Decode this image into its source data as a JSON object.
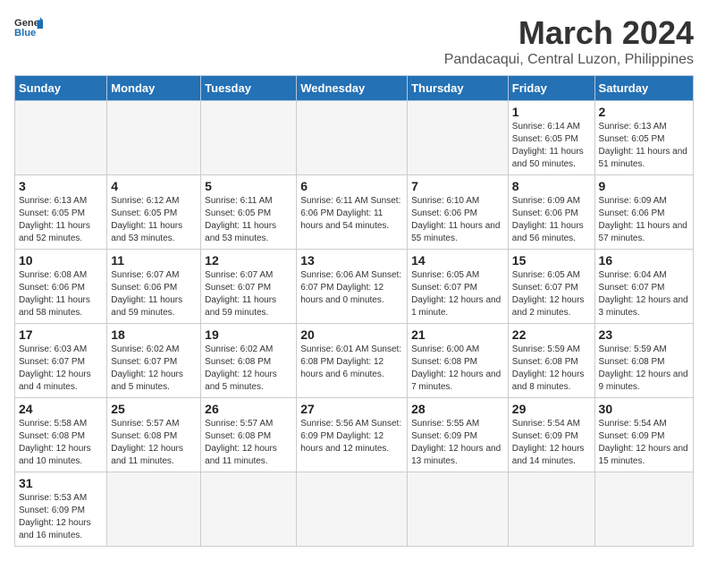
{
  "header": {
    "logo_general": "General",
    "logo_blue": "Blue",
    "month_title": "March 2024",
    "subtitle": "Pandacaqui, Central Luzon, Philippines"
  },
  "days_of_week": [
    "Sunday",
    "Monday",
    "Tuesday",
    "Wednesday",
    "Thursday",
    "Friday",
    "Saturday"
  ],
  "weeks": [
    [
      {
        "day": "",
        "info": ""
      },
      {
        "day": "",
        "info": ""
      },
      {
        "day": "",
        "info": ""
      },
      {
        "day": "",
        "info": ""
      },
      {
        "day": "",
        "info": ""
      },
      {
        "day": "1",
        "info": "Sunrise: 6:14 AM\nSunset: 6:05 PM\nDaylight: 11 hours\nand 50 minutes."
      },
      {
        "day": "2",
        "info": "Sunrise: 6:13 AM\nSunset: 6:05 PM\nDaylight: 11 hours\nand 51 minutes."
      }
    ],
    [
      {
        "day": "3",
        "info": "Sunrise: 6:13 AM\nSunset: 6:05 PM\nDaylight: 11 hours\nand 52 minutes."
      },
      {
        "day": "4",
        "info": "Sunrise: 6:12 AM\nSunset: 6:05 PM\nDaylight: 11 hours\nand 53 minutes."
      },
      {
        "day": "5",
        "info": "Sunrise: 6:11 AM\nSunset: 6:05 PM\nDaylight: 11 hours\nand 53 minutes."
      },
      {
        "day": "6",
        "info": "Sunrise: 6:11 AM\nSunset: 6:06 PM\nDaylight: 11 hours\nand 54 minutes."
      },
      {
        "day": "7",
        "info": "Sunrise: 6:10 AM\nSunset: 6:06 PM\nDaylight: 11 hours\nand 55 minutes."
      },
      {
        "day": "8",
        "info": "Sunrise: 6:09 AM\nSunset: 6:06 PM\nDaylight: 11 hours\nand 56 minutes."
      },
      {
        "day": "9",
        "info": "Sunrise: 6:09 AM\nSunset: 6:06 PM\nDaylight: 11 hours\nand 57 minutes."
      }
    ],
    [
      {
        "day": "10",
        "info": "Sunrise: 6:08 AM\nSunset: 6:06 PM\nDaylight: 11 hours\nand 58 minutes."
      },
      {
        "day": "11",
        "info": "Sunrise: 6:07 AM\nSunset: 6:06 PM\nDaylight: 11 hours\nand 59 minutes."
      },
      {
        "day": "12",
        "info": "Sunrise: 6:07 AM\nSunset: 6:07 PM\nDaylight: 11 hours\nand 59 minutes."
      },
      {
        "day": "13",
        "info": "Sunrise: 6:06 AM\nSunset: 6:07 PM\nDaylight: 12 hours\nand 0 minutes."
      },
      {
        "day": "14",
        "info": "Sunrise: 6:05 AM\nSunset: 6:07 PM\nDaylight: 12 hours\nand 1 minute."
      },
      {
        "day": "15",
        "info": "Sunrise: 6:05 AM\nSunset: 6:07 PM\nDaylight: 12 hours\nand 2 minutes."
      },
      {
        "day": "16",
        "info": "Sunrise: 6:04 AM\nSunset: 6:07 PM\nDaylight: 12 hours\nand 3 minutes."
      }
    ],
    [
      {
        "day": "17",
        "info": "Sunrise: 6:03 AM\nSunset: 6:07 PM\nDaylight: 12 hours\nand 4 minutes."
      },
      {
        "day": "18",
        "info": "Sunrise: 6:02 AM\nSunset: 6:07 PM\nDaylight: 12 hours\nand 5 minutes."
      },
      {
        "day": "19",
        "info": "Sunrise: 6:02 AM\nSunset: 6:08 PM\nDaylight: 12 hours\nand 5 minutes."
      },
      {
        "day": "20",
        "info": "Sunrise: 6:01 AM\nSunset: 6:08 PM\nDaylight: 12 hours\nand 6 minutes."
      },
      {
        "day": "21",
        "info": "Sunrise: 6:00 AM\nSunset: 6:08 PM\nDaylight: 12 hours\nand 7 minutes."
      },
      {
        "day": "22",
        "info": "Sunrise: 5:59 AM\nSunset: 6:08 PM\nDaylight: 12 hours\nand 8 minutes."
      },
      {
        "day": "23",
        "info": "Sunrise: 5:59 AM\nSunset: 6:08 PM\nDaylight: 12 hours\nand 9 minutes."
      }
    ],
    [
      {
        "day": "24",
        "info": "Sunrise: 5:58 AM\nSunset: 6:08 PM\nDaylight: 12 hours\nand 10 minutes."
      },
      {
        "day": "25",
        "info": "Sunrise: 5:57 AM\nSunset: 6:08 PM\nDaylight: 12 hours\nand 11 minutes."
      },
      {
        "day": "26",
        "info": "Sunrise: 5:57 AM\nSunset: 6:08 PM\nDaylight: 12 hours\nand 11 minutes."
      },
      {
        "day": "27",
        "info": "Sunrise: 5:56 AM\nSunset: 6:09 PM\nDaylight: 12 hours\nand 12 minutes."
      },
      {
        "day": "28",
        "info": "Sunrise: 5:55 AM\nSunset: 6:09 PM\nDaylight: 12 hours\nand 13 minutes."
      },
      {
        "day": "29",
        "info": "Sunrise: 5:54 AM\nSunset: 6:09 PM\nDaylight: 12 hours\nand 14 minutes."
      },
      {
        "day": "30",
        "info": "Sunrise: 5:54 AM\nSunset: 6:09 PM\nDaylight: 12 hours\nand 15 minutes."
      }
    ],
    [
      {
        "day": "31",
        "info": "Sunrise: 5:53 AM\nSunset: 6:09 PM\nDaylight: 12 hours\nand 16 minutes."
      },
      {
        "day": "",
        "info": ""
      },
      {
        "day": "",
        "info": ""
      },
      {
        "day": "",
        "info": ""
      },
      {
        "day": "",
        "info": ""
      },
      {
        "day": "",
        "info": ""
      },
      {
        "day": "",
        "info": ""
      }
    ]
  ]
}
